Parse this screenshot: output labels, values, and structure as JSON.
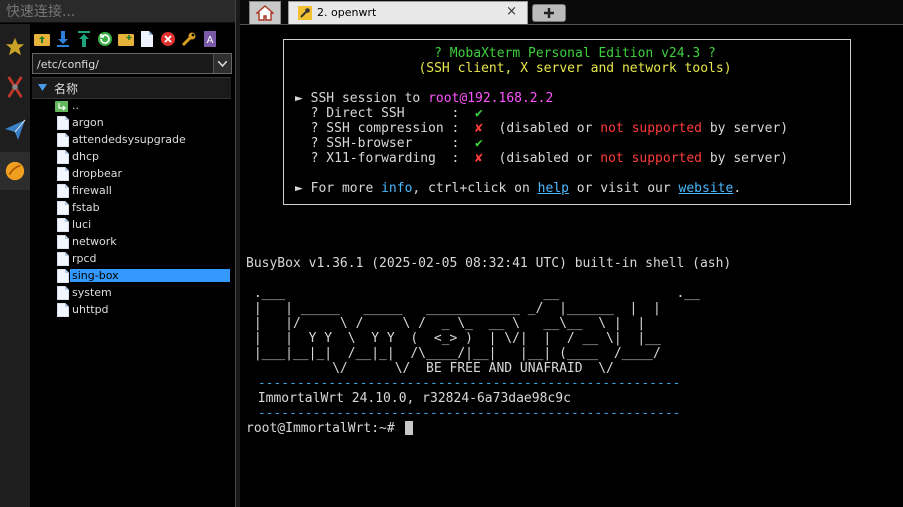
{
  "quick_connect": {
    "placeholder": "快速连接..."
  },
  "sidebar": {
    "path": "/etc/config/",
    "column_header": "名称",
    "parent_dir": "..",
    "files": [
      "argon",
      "attendedsysupgrade",
      "dhcp",
      "dropbear",
      "firewall",
      "fstab",
      "luci",
      "network",
      "rpcd",
      "sing-box",
      "system",
      "uhttpd"
    ],
    "selected_file": "sing-box"
  },
  "tabs": {
    "active_label": "2. openwrt",
    "close_glyph": "×"
  },
  "terminal": {
    "banner_title": "? MobaXterm Personal Edition v24.3 ?",
    "banner_sub": "(SSH client, X server and network tools)",
    "session_prefix": "► SSH session to ",
    "session_host": "root@192.168.2.2",
    "rows": [
      {
        "label": "  ? Direct SSH      :  ",
        "mark": "✔",
        "status": "ok"
      },
      {
        "label": "  ? SSH compression :  ",
        "mark": "✘",
        "status": "bad"
      },
      {
        "label": "  ? SSH-browser     :  ",
        "mark": "✔",
        "status": "ok"
      },
      {
        "label": "  ? X11-forwarding  :  ",
        "mark": "✘",
        "status": "bad"
      }
    ],
    "disabled_note_a": "(disabled",
    "disabled_note_or": " or ",
    "disabled_note_ns": "not supported",
    "disabled_note_end": " by server)",
    "info_prefix": "► For more ",
    "info_word": "info",
    "info_mid": ", ctrl+click on ",
    "help_word": "help",
    "info_mid2": " or visit our ",
    "website_word": "website",
    "info_end": ".",
    "busybox": "BusyBox v1.36.1 (2025-02-05 08:32:41 UTC) built-in shell (ash)",
    "ascii_art": [
      " .___                                 __               .__",
      " |   | _____   _____   ____________ _/  |______  |  |",
      " |   |/     \\ /     \\ /  _ \\_  __ \\   __\\__  \\ |  |",
      " |   |  Y Y  \\  Y Y  (  <_> )  | \\/|  |  / __ \\|  |__",
      " |___|__|_|  /__|_|  /\\____/|__|   |__| (____  /____/",
      "           \\/      \\/  BE FREE AND UNAFRAID  \\/"
    ],
    "dash_line": " ------------------------------------------------------",
    "version": " ImmortalWrt 24.10.0, r32824-6a73dae98c9c",
    "prompt": "root@ImmortalWrt:~# "
  },
  "colors": {
    "selection": "#3399ff",
    "ok": "#3dd13d",
    "bad": "#ff3b3b",
    "host": "#ff55ff",
    "link": "#4bb8ff"
  }
}
